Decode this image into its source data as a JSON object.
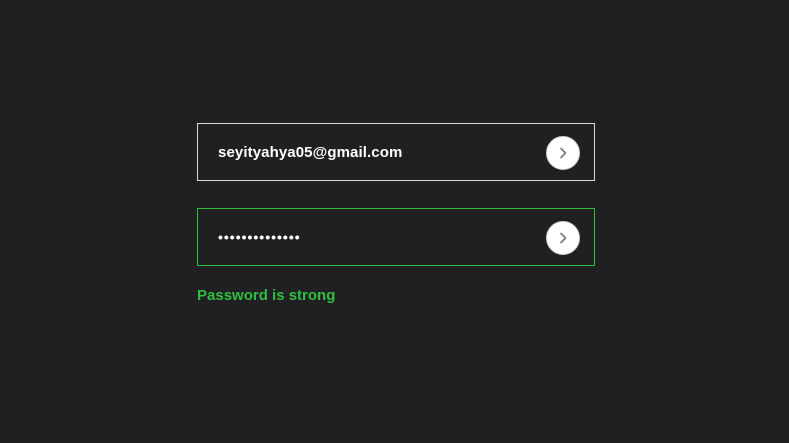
{
  "form": {
    "email": {
      "value": "seyityahya05@gmail.com",
      "submit_icon": "chevron-right-icon"
    },
    "password": {
      "value": "••••••••••••••",
      "submit_icon": "chevron-right-icon"
    },
    "status_message": "Password is strong"
  },
  "colors": {
    "background": "#202022",
    "email_border": "#d9d9d9",
    "password_border": "#2fbf40",
    "status_text": "#2fbf40",
    "input_text": "#ffffff",
    "button_bg": "#ffffff",
    "chevron": "#777777"
  }
}
